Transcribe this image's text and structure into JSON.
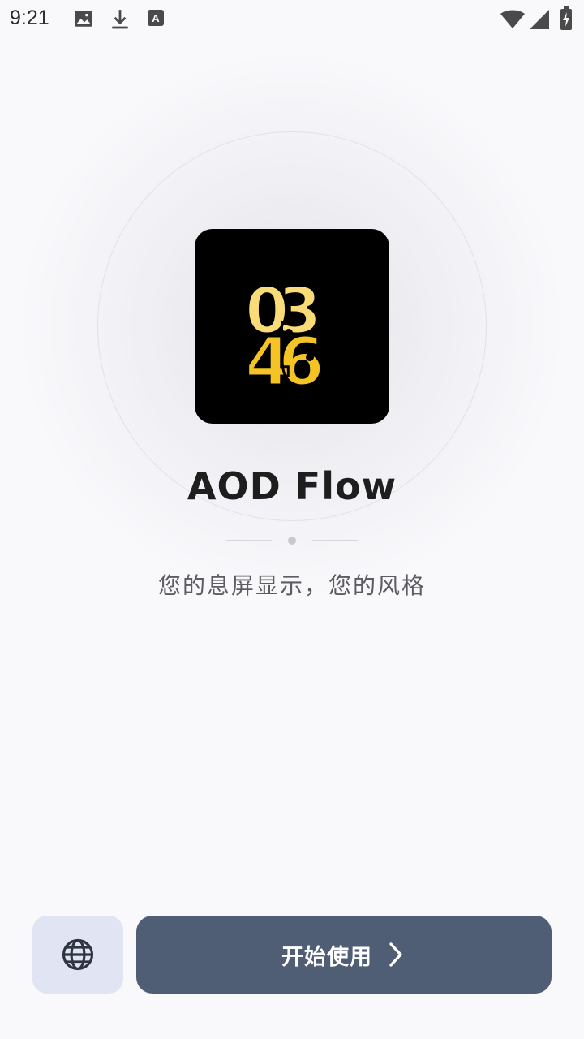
{
  "status_bar": {
    "time": "9:21",
    "icons": [
      "image-icon",
      "download-icon",
      "text-icon",
      "wifi-icon",
      "signal-icon",
      "battery-charging-icon"
    ]
  },
  "app": {
    "name": "AOD Flow",
    "icon_text_top": "03",
    "icon_text_bottom": "46",
    "icon_colors": {
      "background": "#000000",
      "light": "#f9dc78",
      "dark": "#f6c324"
    }
  },
  "tagline": "您的息屏显示，您的风格",
  "actions": {
    "language_icon": "globe-icon",
    "start_label": "开始使用",
    "start_icon": "chevron-right-icon",
    "start_color": "#505e75",
    "language_bg": "#e1e4f2"
  }
}
